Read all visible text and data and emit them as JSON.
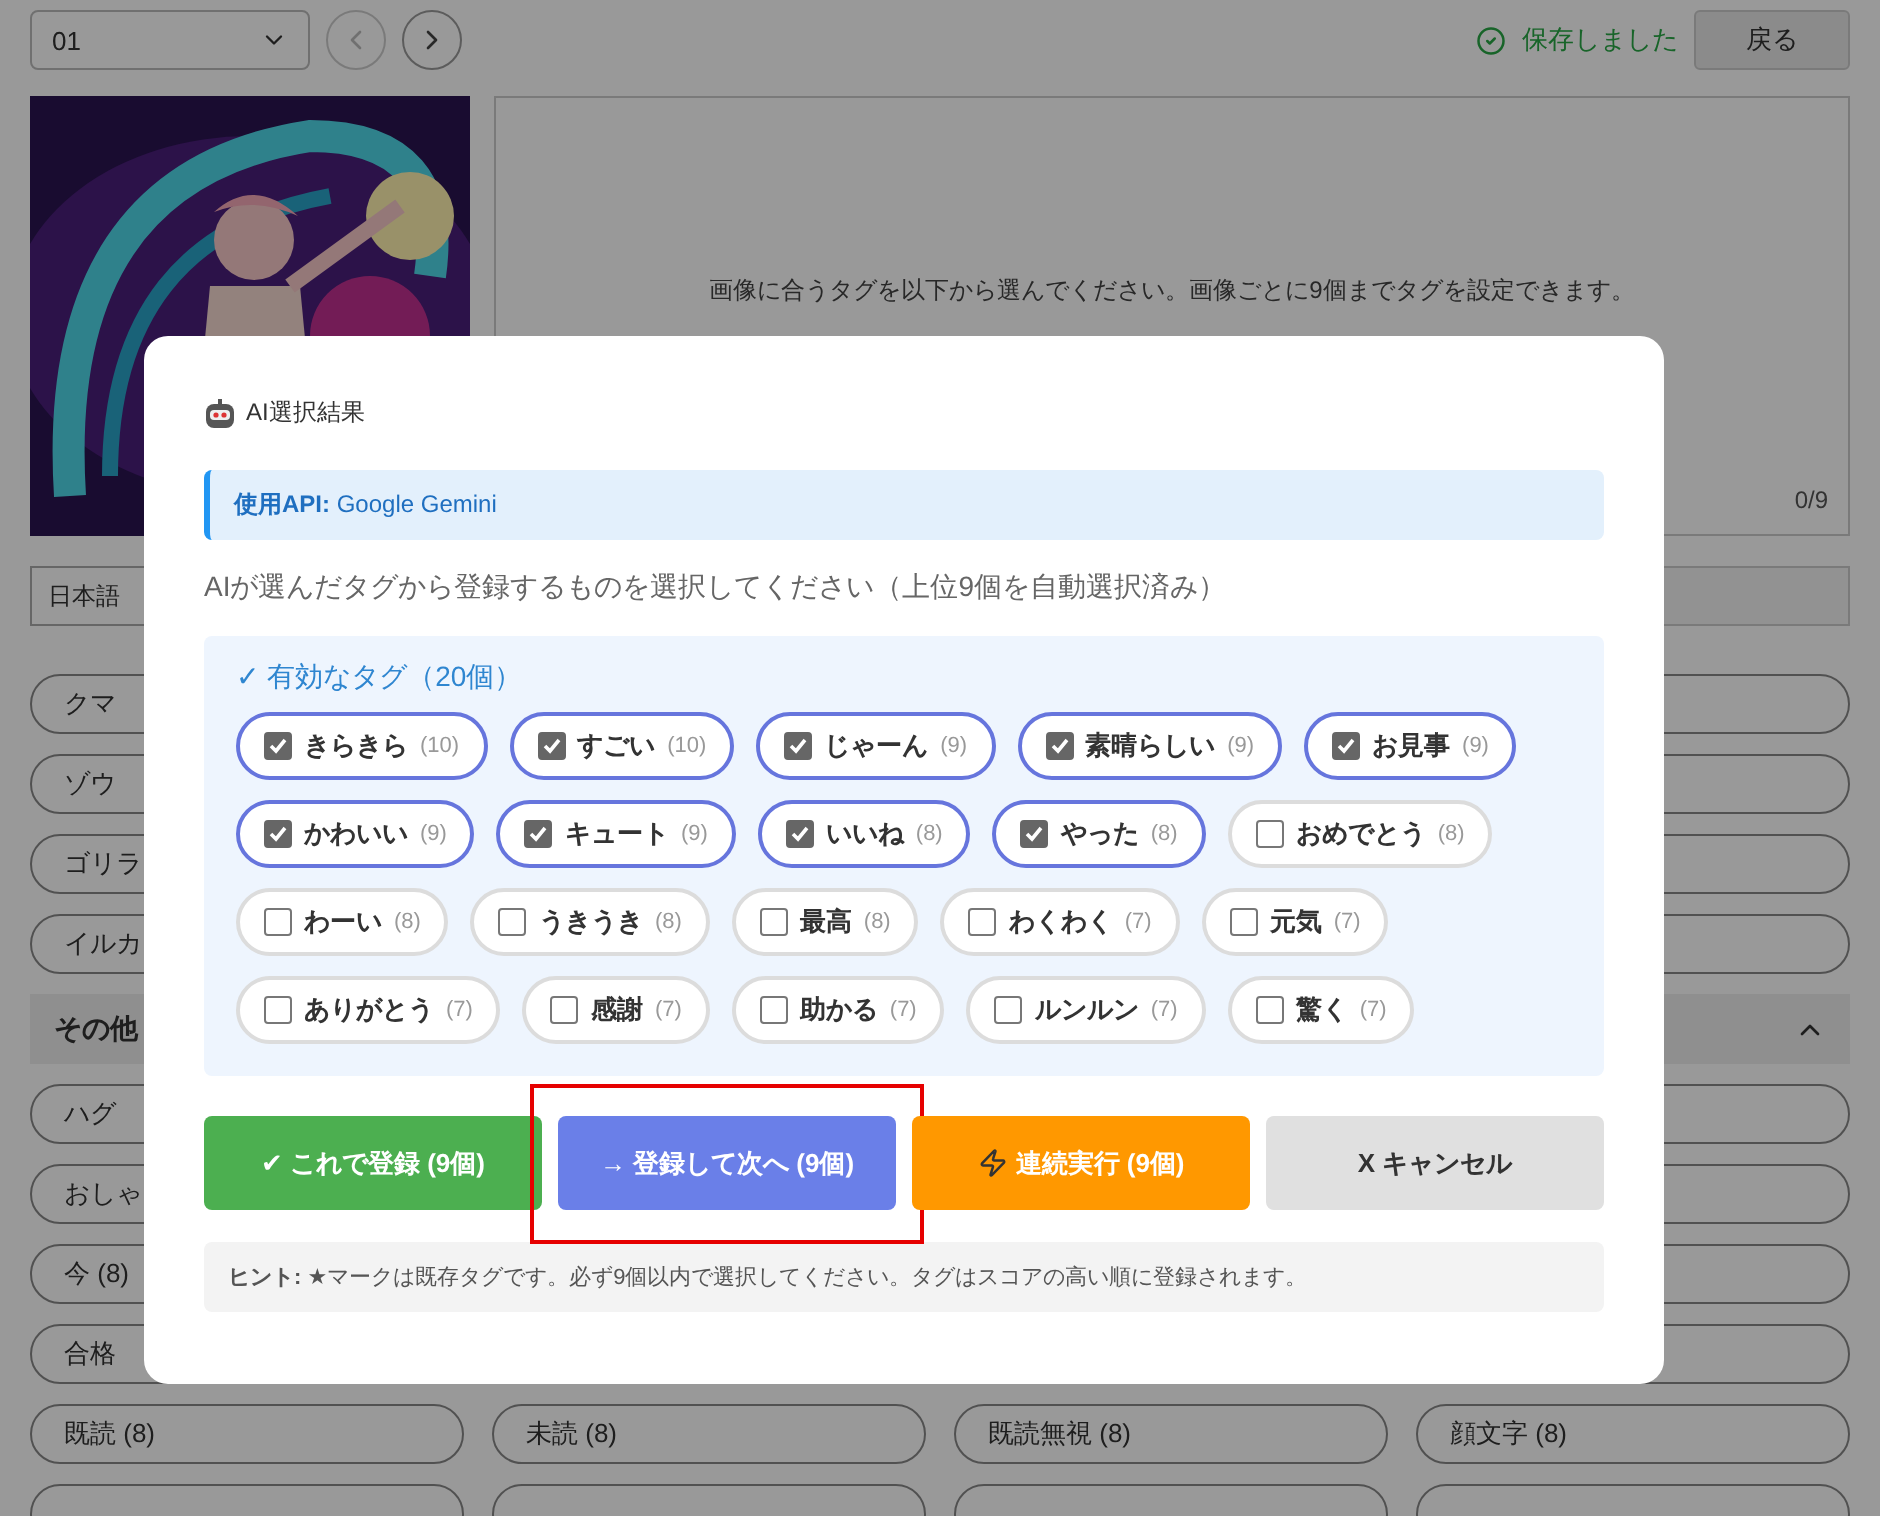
{
  "toolbar": {
    "image_select": "01",
    "prev_disabled": true,
    "status": "保存しました",
    "back_button": "戻る"
  },
  "editor": {
    "instruction": "画像に合うタグを以下から選んでください。画像ごとに9個までタグを設定できます。",
    "counter": "0/9"
  },
  "language_select": "日本語",
  "tag_rows": [
    {
      "cells": [
        "クマ"
      ]
    },
    {
      "cells": [
        "ゾウ"
      ]
    },
    {
      "cells": [
        "ゴリラ"
      ]
    },
    {
      "cells": [
        "イルカ"
      ]
    }
  ],
  "section": {
    "title": "その他",
    "expanded": true
  },
  "section_rows": [
    {
      "cells": [
        "ハグ"
      ]
    },
    {
      "cells": [
        "おしゃ"
      ]
    },
    {
      "cells": [
        "今 (8)"
      ]
    },
    {
      "cells": [
        "合格"
      ]
    },
    {
      "cells": [
        "既読 (8)",
        "未読 (8)",
        "既読無視 (8)",
        "顔文字 (8)"
      ]
    }
  ],
  "dialog": {
    "title": "AI選択結果",
    "api_label": "使用API:",
    "api_value": "Google Gemini",
    "instruction": "AIが選んだタグから登録するものを選択してください（上位9個を自動選択済み）",
    "tags_heading": "✓ 有効なタグ（20個）",
    "tags": [
      {
        "label": "きらきら",
        "count": "(10)",
        "checked": true
      },
      {
        "label": "すごい",
        "count": "(10)",
        "checked": true
      },
      {
        "label": "じゃーん",
        "count": "(9)",
        "checked": true
      },
      {
        "label": "素晴らしい",
        "count": "(9)",
        "checked": true
      },
      {
        "label": "お見事",
        "count": "(9)",
        "checked": true
      },
      {
        "label": "かわいい",
        "count": "(9)",
        "checked": true
      },
      {
        "label": "キュート",
        "count": "(9)",
        "checked": true
      },
      {
        "label": "いいね",
        "count": "(8)",
        "checked": true
      },
      {
        "label": "やった",
        "count": "(8)",
        "checked": true
      },
      {
        "label": "おめでとう",
        "count": "(8)",
        "checked": false
      },
      {
        "label": "わーい",
        "count": "(8)",
        "checked": false
      },
      {
        "label": "うきうき",
        "count": "(8)",
        "checked": false
      },
      {
        "label": "最高",
        "count": "(8)",
        "checked": false
      },
      {
        "label": "わくわく",
        "count": "(7)",
        "checked": false
      },
      {
        "label": "元気",
        "count": "(7)",
        "checked": false
      },
      {
        "label": "ありがとう",
        "count": "(7)",
        "checked": false
      },
      {
        "label": "感謝",
        "count": "(7)",
        "checked": false
      },
      {
        "label": "助かる",
        "count": "(7)",
        "checked": false
      },
      {
        "label": "ルンルン",
        "count": "(7)",
        "checked": false
      },
      {
        "label": "驚く",
        "count": "(7)",
        "checked": false
      }
    ],
    "buttons": [
      {
        "kind": "confirm",
        "label": "✔ これで登録 (9個)",
        "highlighted": false
      },
      {
        "kind": "next",
        "label": "→ 登録して次へ (9個)",
        "highlighted": true
      },
      {
        "kind": "batch",
        "label": "連続実行 (9個)",
        "highlighted": false
      },
      {
        "kind": "cancel",
        "label": "X キャンセル",
        "highlighted": false
      }
    ],
    "hint": "**ヒント:** ★マークは既存タグです。必ず9個以内で選択してください。タグはスコアの高い順に登録されます。"
  }
}
